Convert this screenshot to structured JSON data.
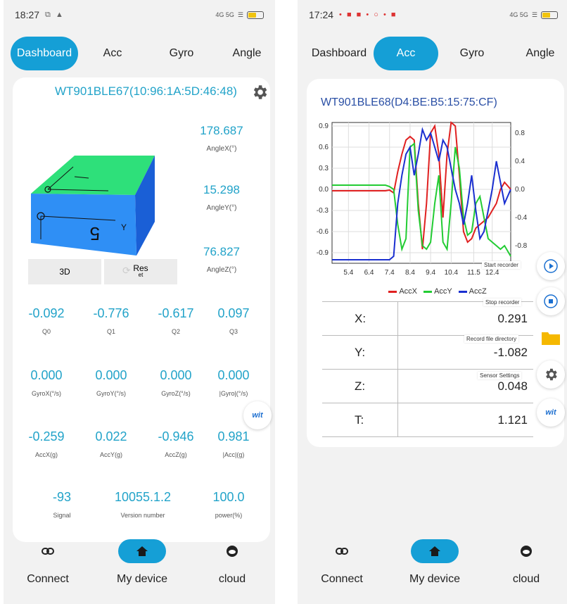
{
  "colors": {
    "accent": "#159fd6",
    "value": "#22a3c9",
    "accx": "#e02020",
    "accy": "#22cc33",
    "accz": "#1a2fd0"
  },
  "bottom_nav": [
    {
      "label": "Connect",
      "icon": "link-icon"
    },
    {
      "label": "My device",
      "icon": "home-icon"
    },
    {
      "label": "cloud",
      "icon": "cloud-icon"
    }
  ],
  "left": {
    "status": {
      "time": "18:27",
      "icons": "⧉ ▲",
      "right": "4G 5G"
    },
    "tabs": [
      "Dashboard",
      "Acc",
      "Gyro",
      "Angle"
    ],
    "active_tab": "Dashboard",
    "device_name": "WT901BLE67(10:96:1A:5D:46:48)",
    "angles": [
      {
        "value": "178.687",
        "label": "AngleX(°)"
      },
      {
        "value": "15.298",
        "label": "AngleY(°)"
      },
      {
        "value": "76.827",
        "label": "AngleZ(°)"
      }
    ],
    "cube_letters": {
      "face": "5",
      "side": "Y"
    },
    "btn_3d": "3D",
    "btn_reset": "Res",
    "btn_reset_sub": "et",
    "rows": [
      [
        {
          "value": "-0.092",
          "label": "Q0"
        },
        {
          "value": "-0.776",
          "label": "Q1"
        },
        {
          "value": "-0.617",
          "label": "Q2"
        },
        {
          "value": "0.097",
          "label": "Q3"
        }
      ],
      [
        {
          "value": "0.000",
          "label": "GyroX(°/s)"
        },
        {
          "value": "0.000",
          "label": "GyroY(°/s)"
        },
        {
          "value": "0.000",
          "label": "GyroZ(°/s)"
        },
        {
          "value": "0.000",
          "label": "|Gyro|(°/s)"
        }
      ],
      [
        {
          "value": "-0.259",
          "label": "AccX(g)"
        },
        {
          "value": "0.022",
          "label": "AccY(g)"
        },
        {
          "value": "-0.946",
          "label": "AccZ(g)"
        },
        {
          "value": "0.981",
          "label": "|Acc|(g)"
        }
      ]
    ],
    "bottom": [
      {
        "value": "-93",
        "label": "Signal"
      },
      {
        "value": "10055.1.2",
        "label": "Version number"
      },
      {
        "value": "100.0",
        "label": "power(%)"
      }
    ],
    "wit_logo": "wit"
  },
  "right": {
    "status": {
      "time": "17:24",
      "icons": "• ■ ■ • ○ • ■",
      "right": "4G 5G"
    },
    "tabs": [
      "Dashboard",
      "Acc",
      "Gyro",
      "Angle"
    ],
    "active_tab": "Acc",
    "device_name": "WT901BLE68(D4:BE:B5:15:75:CF)",
    "table": [
      {
        "key": "X:",
        "value": "0.291"
      },
      {
        "key": "Y:",
        "value": "-1.082"
      },
      {
        "key": "Z:",
        "value": "0.048"
      },
      {
        "key": "T:",
        "value": "1.121"
      }
    ],
    "fab_labels": {
      "start": "Start recorder",
      "stop": "Stop recorder",
      "dir": "Record file directory",
      "settings": "Sensor Settings"
    },
    "wit_logo": "wit"
  },
  "chart_data": {
    "type": "line",
    "title": "",
    "xlabel": "",
    "ylabel": "",
    "x_ticks": [
      "5.4",
      "6.4",
      "7.4",
      "8.4",
      "9.4",
      "10.4",
      "11.5",
      "12.4"
    ],
    "xlim": [
      4.6,
      13.3
    ],
    "ylim_left": [
      -1.05,
      0.95
    ],
    "ylim_right": [
      -1.05,
      0.95
    ],
    "y_ticks_left": [
      "0.9",
      "0.6",
      "0.3",
      "0.0",
      "-0.3",
      "-0.6",
      "-0.9"
    ],
    "y_ticks_right": [
      "0.8",
      "0.4",
      "0.0",
      "-0.4",
      "-0.8"
    ],
    "grid": true,
    "legend_position": "bottom",
    "series": [
      {
        "name": "AccX",
        "color": "#e02020",
        "x": [
          4.6,
          7.2,
          7.4,
          7.6,
          7.8,
          8.0,
          8.2,
          8.4,
          8.6,
          8.8,
          9.0,
          9.2,
          9.4,
          9.6,
          9.8,
          10.0,
          10.2,
          10.4,
          10.6,
          10.8,
          11.0,
          11.2,
          11.4,
          11.6,
          11.8,
          12.0,
          12.2,
          12.4,
          12.6,
          12.8,
          13.0,
          13.3
        ],
        "y": [
          -0.02,
          -0.02,
          -0.01,
          -0.05,
          0.25,
          0.5,
          0.7,
          0.75,
          0.7,
          -0.2,
          -0.85,
          -0.2,
          0.8,
          0.9,
          0.5,
          -0.4,
          0.5,
          0.95,
          0.9,
          0.2,
          -0.6,
          -0.75,
          -0.7,
          -0.55,
          -0.5,
          -0.45,
          -0.4,
          -0.3,
          -0.2,
          0.0,
          0.1,
          0.0
        ]
      },
      {
        "name": "AccY",
        "color": "#22cc33",
        "x": [
          4.6,
          7.2,
          7.4,
          7.6,
          7.8,
          8.0,
          8.2,
          8.4,
          8.6,
          8.8,
          9.0,
          9.2,
          9.4,
          9.6,
          9.8,
          10.0,
          10.2,
          10.4,
          10.6,
          10.8,
          11.0,
          11.2,
          11.4,
          11.6,
          11.8,
          12.0,
          12.2,
          12.4,
          12.6,
          12.8,
          13.0,
          13.3
        ],
        "y": [
          0.06,
          0.06,
          0.04,
          0.0,
          -0.5,
          -0.85,
          -0.7,
          0.6,
          0.65,
          -0.3,
          -0.8,
          -0.85,
          -0.75,
          -0.2,
          0.2,
          -0.75,
          -0.85,
          -0.2,
          0.6,
          0.3,
          -0.4,
          -0.65,
          -0.6,
          -0.2,
          -0.1,
          -0.4,
          -0.7,
          -0.75,
          -0.8,
          -0.85,
          -0.8,
          -0.95
        ]
      },
      {
        "name": "AccZ",
        "color": "#1a2fd0",
        "x": [
          4.6,
          7.2,
          7.4,
          7.6,
          7.8,
          8.0,
          8.2,
          8.4,
          8.6,
          8.8,
          9.0,
          9.2,
          9.4,
          9.6,
          9.8,
          10.0,
          10.2,
          10.4,
          10.6,
          10.8,
          11.0,
          11.2,
          11.4,
          11.6,
          11.8,
          12.0,
          12.2,
          12.4,
          12.6,
          12.8,
          13.0,
          13.3
        ],
        "y": [
          -1.0,
          -1.0,
          -1.0,
          -0.95,
          -0.2,
          0.2,
          0.5,
          0.6,
          0.2,
          0.5,
          0.85,
          0.7,
          0.8,
          0.6,
          0.4,
          0.7,
          0.6,
          0.3,
          0.0,
          -0.2,
          -0.5,
          -0.2,
          0.2,
          -0.3,
          -0.7,
          -0.6,
          -0.3,
          0.0,
          0.4,
          0.1,
          -0.2,
          0.0
        ]
      }
    ]
  }
}
